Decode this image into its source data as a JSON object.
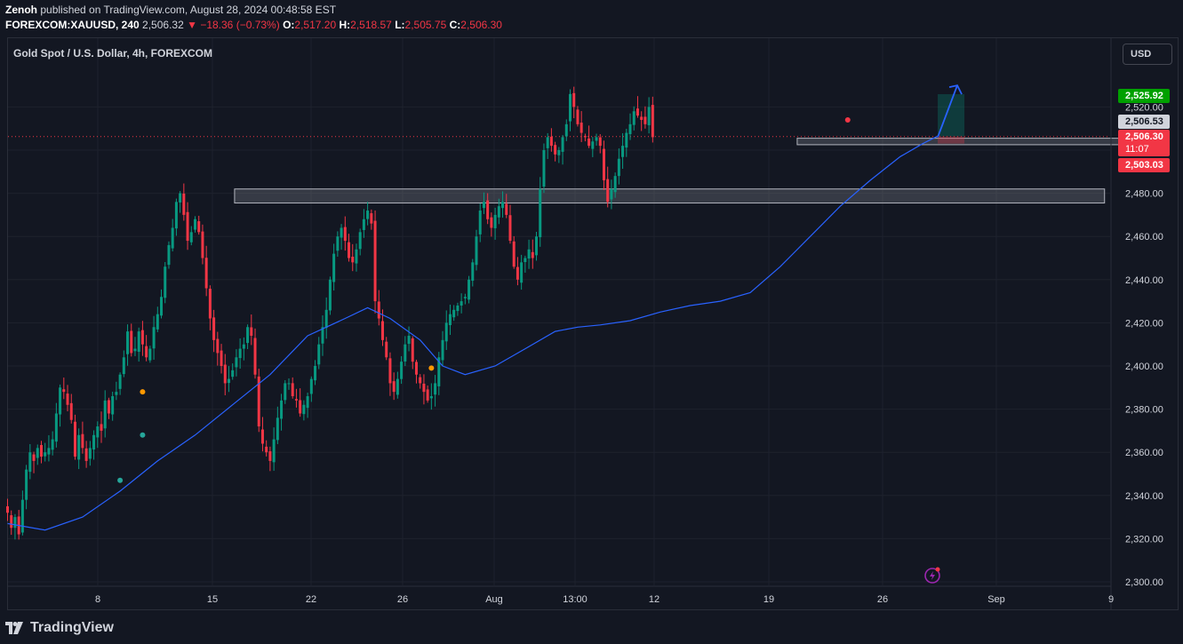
{
  "header": {
    "publisher": "Zenoh",
    "published_text": "published on TradingView.com, August 28, 2024 00:48:58 EST",
    "symbol": "FOREXCOM:XAUUSD, 240",
    "last": "2,506.32",
    "change": "▼ −18.36 (−0.73%)",
    "o_label": "O:",
    "o_value": "2,517.20",
    "h_label": "H:",
    "h_value": "2,518.57",
    "l_label": "L:",
    "l_value": "2,505.75",
    "c_label": "C:",
    "c_value": "2,506.30"
  },
  "legend": "Gold Spot / U.S. Dollar, 4h, FOREXCOM",
  "currency_button": "USD",
  "price_tags": {
    "target": "2,525.92",
    "ma": "2,506.53",
    "last": "2,506.30",
    "countdown": "11:07",
    "stop": "2,503.03"
  },
  "footer": {
    "brand": "TradingView"
  },
  "colors": {
    "background": "#131722",
    "grid": "#1e222d",
    "up": "#089981",
    "down": "#f23645",
    "ma": "#2962ff",
    "zone": "#787b86",
    "arrow": "#2962ff",
    "target_tag": "#089981",
    "stop_tag": "#f23645"
  },
  "chart_data": {
    "type": "candlestick",
    "title": "Gold Spot / U.S. Dollar, 4h, FOREXCOM",
    "y_ticks": [
      2300,
      2320,
      2340,
      2360,
      2380,
      2400,
      2420,
      2440,
      2460,
      2480,
      2500,
      2520
    ],
    "y_tick_labels": [
      "2,300.00",
      "2,320.00",
      "2,340.00",
      "2,360.00",
      "2,380.00",
      "2,400.00",
      "2,420.00",
      "2,440.00",
      "2,460.00",
      "2,480.00",
      "2,500.00",
      "2,520.00"
    ],
    "ylim": [
      2297,
      2540
    ],
    "x_tick_labels": [
      "8",
      "15",
      "22",
      "26",
      "Aug",
      "13:00",
      "12",
      "19",
      "26",
      "Sep",
      "9"
    ],
    "last_price": 2506.3,
    "close_series": [
      2332,
      2325,
      2330,
      2322,
      2338,
      2352,
      2360,
      2356,
      2362,
      2358,
      2360,
      2362,
      2366,
      2378,
      2390,
      2388,
      2382,
      2375,
      2358,
      2368,
      2362,
      2356,
      2362,
      2368,
      2372,
      2370,
      2384,
      2378,
      2386,
      2388,
      2396,
      2404,
      2416,
      2406,
      2408,
      2416,
      2410,
      2404,
      2408,
      2418,
      2424,
      2432,
      2446,
      2456,
      2464,
      2476,
      2480,
      2470,
      2458,
      2462,
      2468,
      2462,
      2450,
      2436,
      2422,
      2412,
      2406,
      2400,
      2392,
      2394,
      2398,
      2404,
      2408,
      2410,
      2418,
      2414,
      2396,
      2372,
      2364,
      2360,
      2356,
      2366,
      2376,
      2384,
      2392,
      2392,
      2386,
      2384,
      2378,
      2382,
      2386,
      2394,
      2400,
      2410,
      2418,
      2426,
      2440,
      2452,
      2460,
      2464,
      2458,
      2450,
      2448,
      2454,
      2462,
      2468,
      2472,
      2466,
      2430,
      2422,
      2412,
      2404,
      2392,
      2388,
      2394,
      2402,
      2410,
      2414,
      2402,
      2396,
      2392,
      2388,
      2384,
      2386,
      2392,
      2404,
      2412,
      2420,
      2424,
      2426,
      2428,
      2430,
      2432,
      2440,
      2448,
      2460,
      2472,
      2476,
      2468,
      2464,
      2470,
      2474,
      2476,
      2470,
      2458,
      2446,
      2440,
      2448,
      2450,
      2454,
      2450,
      2460,
      2482,
      2500,
      2506,
      2502,
      2498,
      2500,
      2506,
      2512,
      2526,
      2520,
      2512,
      2508,
      2506,
      2502,
      2504,
      2506,
      2502,
      2486,
      2476,
      2482,
      2488,
      2496,
      2502,
      2508,
      2512,
      2518,
      2516,
      2514,
      2512,
      2520,
      2506
    ],
    "moving_average": {
      "points": [
        [
          0,
          2327
        ],
        [
          10,
          2324
        ],
        [
          20,
          2330
        ],
        [
          30,
          2342
        ],
        [
          40,
          2356
        ],
        [
          50,
          2368
        ],
        [
          60,
          2382
        ],
        [
          70,
          2396
        ],
        [
          80,
          2414
        ],
        [
          90,
          2422
        ],
        [
          96,
          2427
        ],
        [
          102,
          2422
        ],
        [
          110,
          2412
        ],
        [
          116,
          2400
        ],
        [
          122,
          2396
        ],
        [
          130,
          2400
        ],
        [
          138,
          2408
        ],
        [
          146,
          2416
        ],
        [
          152,
          2418
        ],
        [
          158,
          2419
        ],
        [
          166,
          2421
        ],
        [
          174,
          2425
        ],
        [
          182,
          2428
        ],
        [
          190,
          2430
        ],
        [
          198,
          2434
        ],
        [
          206,
          2446
        ],
        [
          214,
          2460
        ],
        [
          222,
          2474
        ],
        [
          230,
          2486
        ],
        [
          238,
          2497
        ],
        [
          244,
          2503
        ],
        [
          248,
          2506.5
        ]
      ]
    },
    "zones": [
      {
        "name": "upper-zone",
        "from_bar": 211,
        "to_bar": 301,
        "low": 2502.5,
        "high": 2505.5
      },
      {
        "name": "lower-zone",
        "from_bar": 61,
        "to_bar": 292,
        "low": 2475.5,
        "high": 2482
      }
    ],
    "position": {
      "entry": 2506.3,
      "target": 2525.92,
      "stop": 2503.03
    },
    "signals": [
      {
        "bar": 36,
        "price": 2388,
        "color": "#ff9800",
        "kind": "above"
      },
      {
        "bar": 36,
        "price": 2368,
        "color": "#26a69a",
        "kind": "below"
      },
      {
        "bar": 30,
        "price": 2347,
        "color": "#26a69a",
        "kind": "below"
      },
      {
        "bar": 113,
        "price": 2399,
        "color": "#ff9800",
        "kind": "above"
      },
      {
        "bar": 224,
        "price": 2514,
        "color": "#f23645",
        "kind": "above"
      }
    ]
  }
}
